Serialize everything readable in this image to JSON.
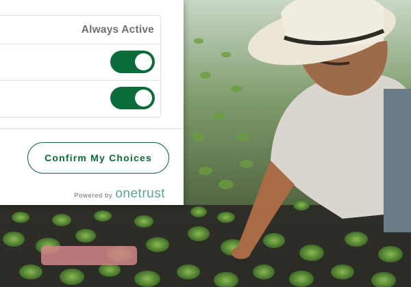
{
  "preferences": {
    "categories": [
      {
        "status_label": "Always Active"
      },
      {
        "toggle_state": "on"
      },
      {
        "toggle_state": "on"
      }
    ],
    "confirm_label": "Confirm My Choices",
    "footer": {
      "powered_by_label": "Powered by",
      "brand_name": "onetrust"
    }
  },
  "colors": {
    "accent": "#0a6b3b",
    "brand": "#5aa58e"
  }
}
